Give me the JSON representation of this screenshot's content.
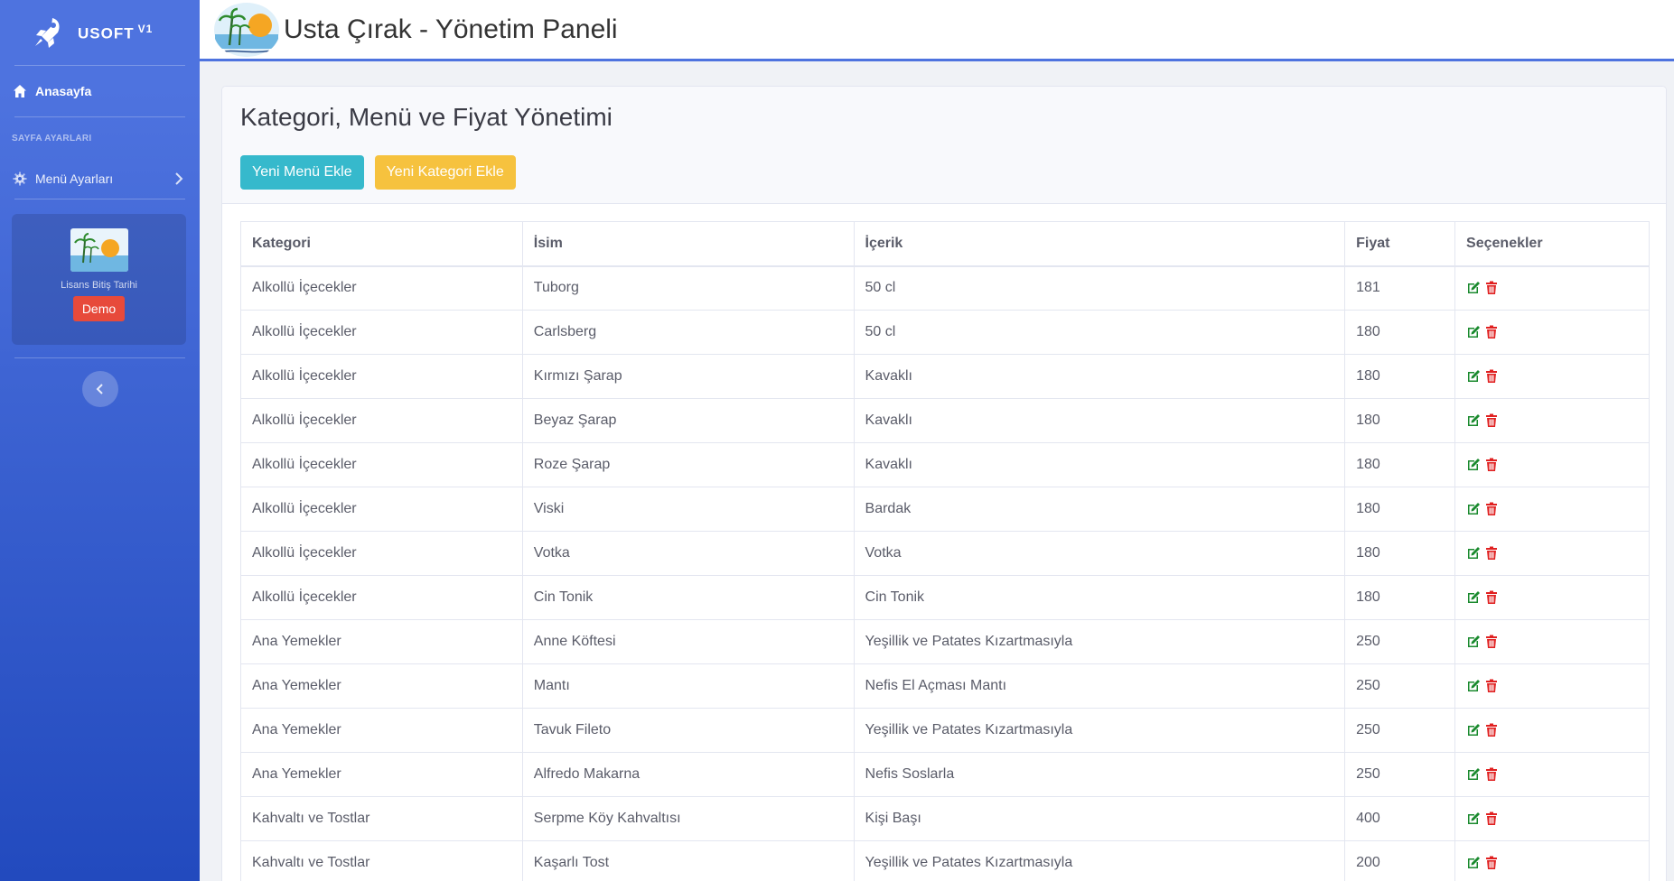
{
  "brand": {
    "name": "USOFT",
    "version": "V1"
  },
  "sidebar": {
    "home_label": "Anasayfa",
    "section_heading": "SAYFA AYARLARI",
    "menu_settings_label": "Menü Ayarları",
    "license_label": "Lisans Bitiş Tarihi",
    "license_badge": "Demo"
  },
  "topbar": {
    "title": "Usta Çırak - Yönetim Paneli"
  },
  "main": {
    "title": "Kategori, Menü ve Fiyat Yönetimi",
    "add_menu_button": "Yeni Menü Ekle",
    "add_category_button": "Yeni Kategori Ekle"
  },
  "table": {
    "headers": [
      "Kategori",
      "İsim",
      "İçerik",
      "Fiyat",
      "Seçenekler"
    ],
    "rows": [
      [
        "Alkollü İçecekler",
        "Tuborg",
        "50 cl",
        "181"
      ],
      [
        "Alkollü İçecekler",
        "Carlsberg",
        "50 cl",
        "180"
      ],
      [
        "Alkollü İçecekler",
        "Kırmızı Şarap",
        "Kavaklı",
        "180"
      ],
      [
        "Alkollü İçecekler",
        "Beyaz Şarap",
        "Kavaklı",
        "180"
      ],
      [
        "Alkollü İçecekler",
        "Roze Şarap",
        "Kavaklı",
        "180"
      ],
      [
        "Alkollü İçecekler",
        "Viski",
        "Bardak",
        "180"
      ],
      [
        "Alkollü İçecekler",
        "Votka",
        "Votka",
        "180"
      ],
      [
        "Alkollü İçecekler",
        "Cin Tonik",
        "Cin Tonik",
        "180"
      ],
      [
        "Ana Yemekler",
        "Anne Köftesi",
        "Yeşillik ve Patates Kızartmasıyla",
        "250"
      ],
      [
        "Ana Yemekler",
        "Mantı",
        "Nefis El Açması Mantı",
        "250"
      ],
      [
        "Ana Yemekler",
        "Tavuk Fileto",
        "Yeşillik ve Patates Kızartmasıyla",
        "250"
      ],
      [
        "Ana Yemekler",
        "Alfredo Makarna",
        "Nefis Soslarla",
        "250"
      ],
      [
        "Kahvaltı ve Tostlar",
        "Serpme Köy Kahvaltısı",
        "Kişi Başı",
        "400"
      ],
      [
        "Kahvaltı ve Tostlar",
        "Kaşarlı Tost",
        "Yeşillik ve Patates Kızartmasıyla",
        "200"
      ]
    ]
  },
  "colors": {
    "primary": "#4e73df",
    "info": "#36b9cc",
    "warning": "#f6c23e",
    "danger": "#e74a3b",
    "edit": "#1a8a2e"
  }
}
